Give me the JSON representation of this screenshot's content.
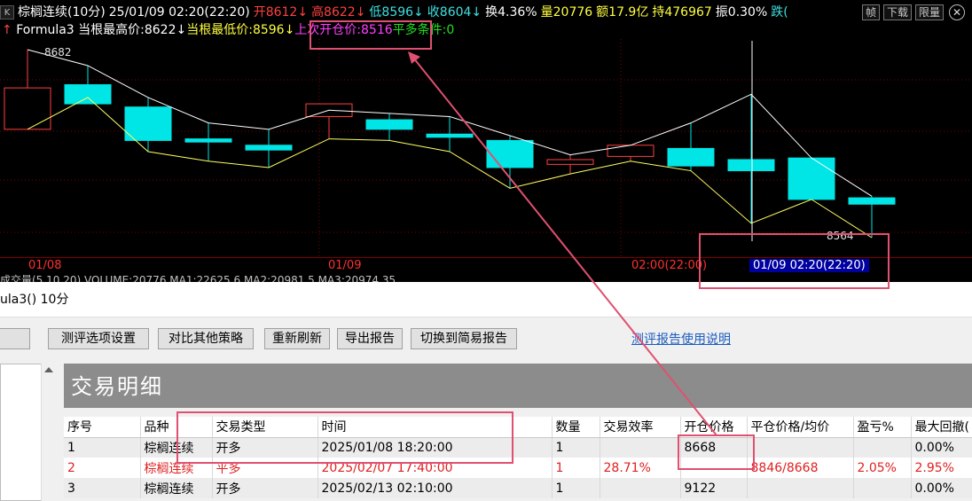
{
  "chart": {
    "header": {
      "badge": "K",
      "name": "棕榈连续(10分)",
      "datetime": "25/01/09 02:20(22:20)",
      "open": "开8612↓",
      "high": "高8622↓",
      "low": "低8596↓",
      "close": "收8604↓",
      "turnover": "换4.36%",
      "volume": "量20776",
      "amount": "额17.9亿",
      "position": "持476967",
      "amplitude": "振0.30%",
      "change": "跌(",
      "buttons": [
        "帧",
        "下载",
        "限量"
      ],
      "close_symbol": "✕"
    },
    "formula_line": {
      "arrow": "↑",
      "name": "Formula3",
      "max_high": "当根最高价:8622↓",
      "min_low": "当根最低价:8596↓",
      "last_open": "上次开仓价:8516",
      "exit_cond": "平多条件:0"
    },
    "price_high_label": "8682",
    "price_low_label": "8564",
    "dates": [
      "01/08",
      "01/09",
      "02:00(22:00)"
    ],
    "date_highlight": "01/09 02:20(22:20)",
    "indicator_line": "成交量(5,10,20) VOLUME:20776  MA1:22625.6  MA2:20981.5  MA3:20974.35",
    "colors": {
      "up": "#ff4040",
      "down": "#00e5e5",
      "ma": "#ffffff",
      "line2": "#ffff60",
      "annotation": "#e05070"
    },
    "candles": [
      {
        "o": 8632,
        "h": 8682,
        "l": 8632,
        "c": 8658
      },
      {
        "o": 8660,
        "h": 8672,
        "l": 8652,
        "c": 8648
      },
      {
        "o": 8646,
        "h": 8652,
        "l": 8618,
        "c": 8625
      },
      {
        "o": 8626,
        "h": 8636,
        "l": 8612,
        "c": 8624
      },
      {
        "o": 8622,
        "h": 8632,
        "l": 8608,
        "c": 8619
      },
      {
        "o": 8640,
        "h": 8644,
        "l": 8626,
        "c": 8648
      },
      {
        "o": 8638,
        "h": 8642,
        "l": 8625,
        "c": 8632
      },
      {
        "o": 8629,
        "h": 8640,
        "l": 8618,
        "c": 8627
      },
      {
        "o": 8625,
        "h": 8628,
        "l": 8595,
        "c": 8608
      },
      {
        "o": 8610,
        "h": 8616,
        "l": 8604,
        "c": 8613
      },
      {
        "o": 8615,
        "h": 8622,
        "l": 8612,
        "c": 8622
      },
      {
        "o": 8620,
        "h": 8636,
        "l": 8606,
        "c": 8609
      },
      {
        "o": 8613,
        "h": 8654,
        "l": 8573,
        "c": 8606
      },
      {
        "o": 8614,
        "h": 8614,
        "l": 8588,
        "c": 8588
      },
      {
        "o": 8589,
        "h": 8590,
        "l": 8564,
        "c": 8585
      }
    ]
  },
  "report": {
    "title": "ula3() 10分",
    "toolbar": {
      "buttons": [
        "测评选项设置",
        "对比其他策略",
        "重新刷新",
        "导出报告",
        "切换到简易报告"
      ],
      "help_link": "测评报告使用说明"
    },
    "detail_title": "交易明细",
    "table": {
      "headers": [
        "序号",
        "品种",
        "交易类型",
        "时间",
        "数量",
        "交易效率",
        "开仓价格",
        "平仓价格/均价",
        "盈亏%",
        "最大回撤("
      ],
      "rows": [
        [
          "1",
          "棕榈连续",
          "开多",
          "2025/01/08 18:20:00",
          "1",
          "",
          "8668",
          "",
          "",
          "0.00%"
        ],
        [
          "2",
          "棕榈连续",
          "平多",
          "2025/02/07 17:40:00",
          "1",
          "28.71%",
          "",
          "8846/8668",
          "2.05%",
          "2.95%"
        ],
        [
          "3",
          "棕榈连续",
          "开多",
          "2025/02/13 02:10:00",
          "1",
          "",
          "9122",
          "",
          "",
          "0.00%"
        ]
      ]
    }
  }
}
